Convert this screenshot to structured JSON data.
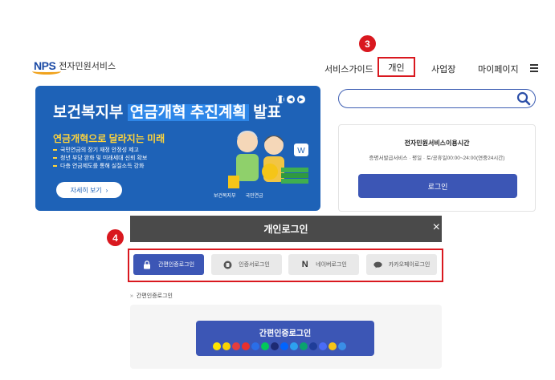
{
  "header": {
    "logo_text": "NPS",
    "site_name": "전자민원서비스",
    "nav": [
      {
        "label": "서비스가이드"
      },
      {
        "label": "개인"
      },
      {
        "label": "사업장"
      },
      {
        "label": "마이페이지"
      }
    ]
  },
  "annotations": {
    "step3": "3",
    "step4": "4",
    "highlight_color": "#d9181f"
  },
  "banner": {
    "title_pre": "보건복지부",
    "title_hl": "연금개혁 추진계획",
    "title_post": "발표",
    "subtitle": "연금개혁으로 달라지는 미래",
    "bullets": [
      "국민연금의 장기 재정 안정성 제고",
      "청년 부담 완화 및 미래세대 신뢰 확보",
      "다층 연금제도를 통해 실질소득 강화"
    ],
    "detail_button": "자세히 보기",
    "org1": "보건복지부",
    "org2": "국민연금",
    "colors": {
      "bg": "#1e62b7",
      "accent": "#ffd43b"
    }
  },
  "search": {
    "placeholder": "",
    "value": ""
  },
  "service_card": {
    "title": "전자민원서비스이용시간",
    "hours": "증명서발급서비스 · 평일 · 토/공휴일00:00~24:00(연중24시간)",
    "login_button": "로그인"
  },
  "login_modal": {
    "title": "개인로그인",
    "close": "×",
    "tabs": [
      {
        "label": "간편인증로그인",
        "icon": "lock-icon",
        "active": true
      },
      {
        "label": "인증서로그인",
        "icon": "certificate-icon",
        "active": false
      },
      {
        "label": "네이버로그인",
        "icon": "naver-icon",
        "active": false
      },
      {
        "label": "카카오페이로그인",
        "icon": "kakaopay-icon",
        "active": false
      }
    ],
    "section_label": "간편인증로그인",
    "easy_login_button": "간편인증로그인",
    "accent": "#3c56b5"
  }
}
